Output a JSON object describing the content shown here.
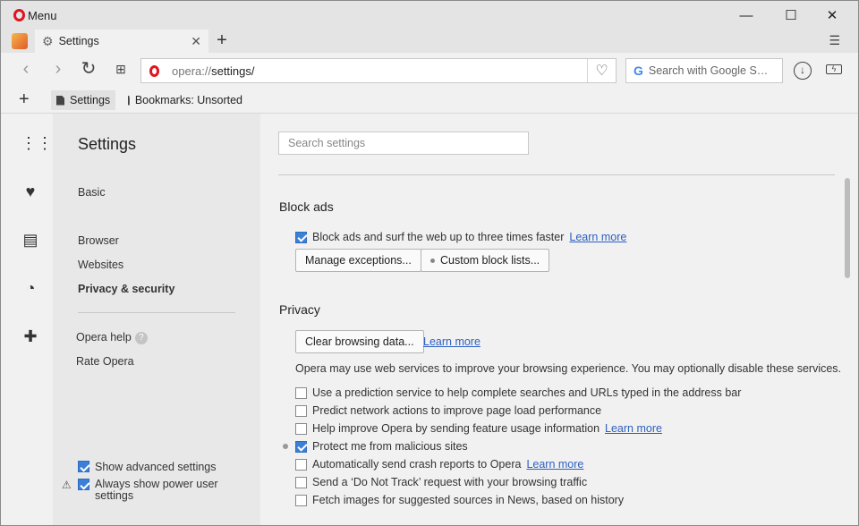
{
  "window": {
    "menu_label": "Menu",
    "minimize": "—",
    "maximize": "☐",
    "close": "✕"
  },
  "tabs": {
    "active_label": "Settings",
    "close": "✕",
    "new_tab": "+",
    "tab_menu": "☰"
  },
  "address": {
    "url_scheme": "opera://",
    "url_path": "settings/",
    "search_placeholder": "Search with Google S…"
  },
  "bookmarks": {
    "add": "+",
    "items": [
      {
        "label": "Settings"
      },
      {
        "label": "Bookmarks: Unsorted"
      }
    ]
  },
  "sidebar_icons": [
    "speed-dial-icon",
    "heart-icon",
    "news-icon",
    "history-icon",
    "extensions-icon"
  ],
  "nav": {
    "title": "Settings",
    "items": [
      {
        "label": "Basic"
      },
      {
        "label": "Browser"
      },
      {
        "label": "Websites"
      },
      {
        "label": "Privacy & security"
      }
    ],
    "help": "Opera help",
    "rate": "Rate Opera",
    "show_advanced": "Show advanced settings",
    "always_power": "Always show power user settings"
  },
  "main": {
    "search_placeholder": "Search settings",
    "block_ads": {
      "heading": "Block ads",
      "checkbox_label": "Block ads and surf the web up to three times faster",
      "learn_more": "Learn more",
      "btn_exceptions": "Manage exceptions...",
      "btn_custom": "Custom block lists..."
    },
    "privacy": {
      "heading": "Privacy",
      "btn_clear": "Clear browsing data...",
      "learn_more": "Learn more",
      "description": "Opera may use web services to improve your browsing experience. You may optionally disable these services.",
      "options": [
        {
          "label": "Use a prediction service to help complete searches and URLs typed in the address bar",
          "checked": false,
          "link": ""
        },
        {
          "label": "Predict network actions to improve page load performance",
          "checked": false,
          "link": ""
        },
        {
          "label": "Help improve Opera by sending feature usage information",
          "checked": false,
          "link": "Learn more"
        },
        {
          "label": "Protect me from malicious sites",
          "checked": true,
          "link": ""
        },
        {
          "label": "Automatically send crash reports to Opera",
          "checked": false,
          "link": "Learn more"
        },
        {
          "label": "Send a ‘Do Not Track’ request with your browsing traffic",
          "checked": false,
          "link": ""
        },
        {
          "label": "Fetch images for suggested sources in News, based on history",
          "checked": false,
          "link": ""
        }
      ]
    }
  }
}
